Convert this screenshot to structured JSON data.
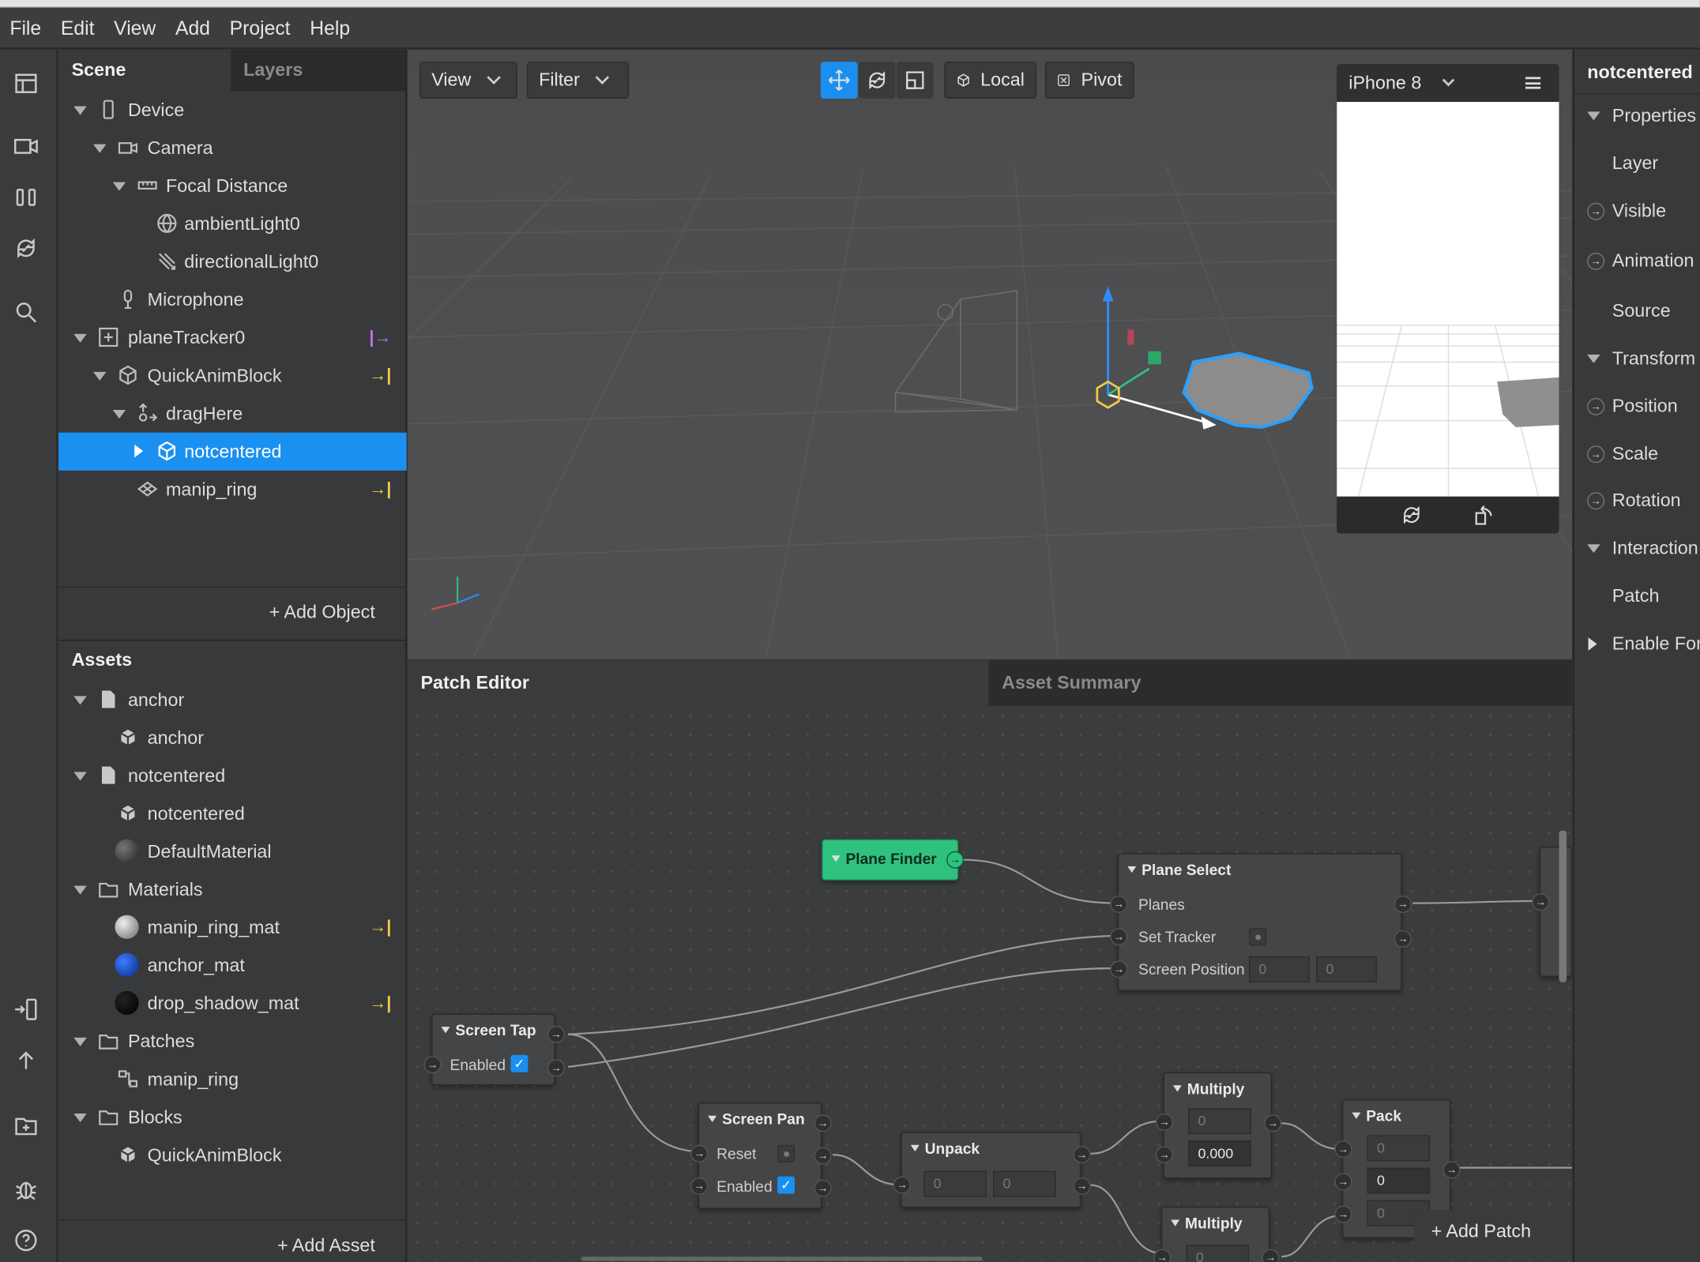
{
  "menu": [
    "File",
    "Edit",
    "View",
    "Add",
    "Project",
    "Help"
  ],
  "scene": {
    "tabs": {
      "scene": "Scene",
      "layers": "Layers"
    },
    "items": [
      {
        "label": "Device"
      },
      {
        "label": "Camera"
      },
      {
        "label": "Focal Distance"
      },
      {
        "label": "ambientLight0"
      },
      {
        "label": "directionalLight0"
      },
      {
        "label": "Microphone"
      },
      {
        "label": "planeTracker0",
        "mark": "|→"
      },
      {
        "label": "QuickAnimBlock",
        "mark": "→|"
      },
      {
        "label": "dragHere"
      },
      {
        "label": "notcentered"
      },
      {
        "label": "manip_ring",
        "mark": "→|"
      }
    ],
    "add_object": "+ Add Object"
  },
  "assets": {
    "title": "Assets",
    "items": [
      {
        "label": "anchor"
      },
      {
        "label": "anchor"
      },
      {
        "label": "notcentered"
      },
      {
        "label": "notcentered"
      },
      {
        "label": "DefaultMaterial"
      },
      {
        "label": "Materials"
      },
      {
        "label": "manip_ring_mat",
        "mark": "→|"
      },
      {
        "label": "anchor_mat"
      },
      {
        "label": "drop_shadow_mat",
        "mark": "→|"
      },
      {
        "label": "Patches"
      },
      {
        "label": "manip_ring"
      },
      {
        "label": "Blocks"
      },
      {
        "label": "QuickAnimBlock"
      }
    ],
    "add_asset": "+ Add Asset"
  },
  "viewport": {
    "view_label": "View",
    "filter_label": "Filter",
    "local_label": "Local",
    "pivot_label": "Pivot",
    "device_name": "iPhone 8"
  },
  "patch_editor": {
    "tab_editor": "Patch Editor",
    "tab_summary": "Asset Summary",
    "add_patch": "+ Add Patch",
    "nodes": {
      "plane_finder": {
        "title": "Plane Finder"
      },
      "plane_select": {
        "title": "Plane Select",
        "planes": "Planes",
        "set_tracker": "Set Tracker",
        "screen_position": "Screen Position",
        "x": "0",
        "y": "0"
      },
      "screen_tap": {
        "title": "Screen Tap",
        "enabled": "Enabled"
      },
      "screen_pan": {
        "title": "Screen Pan",
        "reset": "Reset",
        "enabled": "Enabled"
      },
      "unpack": {
        "title": "Unpack",
        "x": "0",
        "y": "0"
      },
      "multiply1": {
        "title": "Multiply",
        "a": "0",
        "b": "0.000"
      },
      "multiply2": {
        "title": "Multiply",
        "a": "0"
      },
      "pack": {
        "title": "Pack",
        "x": "0",
        "y": "0",
        "z": "0"
      }
    }
  },
  "inspector": {
    "title": "notcentered",
    "rows": [
      {
        "label": "Properties"
      },
      {
        "label": "Layer"
      },
      {
        "label": "Visible"
      },
      {
        "label": "Animation"
      },
      {
        "label": "Source"
      },
      {
        "label": "Transform"
      },
      {
        "label": "Position"
      },
      {
        "label": "Scale"
      },
      {
        "label": "Rotation"
      },
      {
        "label": "Interaction"
      },
      {
        "label": "Patch"
      },
      {
        "label": "Enable For"
      }
    ]
  },
  "colors": {
    "accent": "#1a90f0",
    "node_green": "#2ec27e",
    "block_mark": "#f2c94c",
    "tracker_mark": "#c86cf0"
  }
}
